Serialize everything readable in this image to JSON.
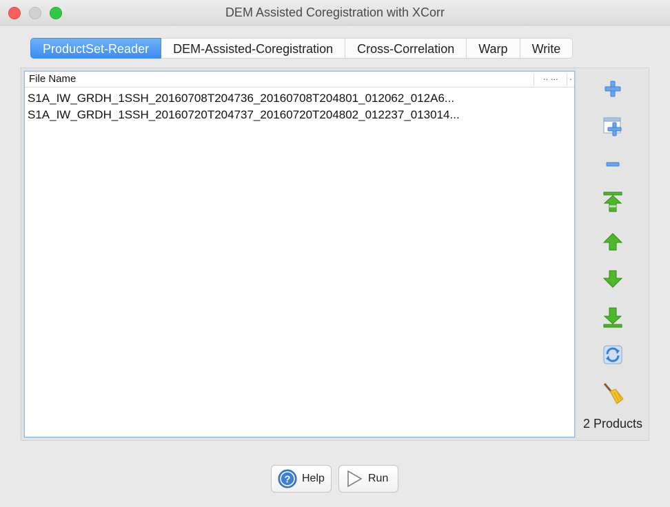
{
  "window": {
    "title": "DEM Assisted Coregistration with XCorr"
  },
  "tabs": [
    {
      "label": "ProductSet-Reader",
      "active": true
    },
    {
      "label": "DEM-Assisted-Coregistration",
      "active": false
    },
    {
      "label": "Cross-Correlation",
      "active": false
    },
    {
      "label": "Warp",
      "active": false
    },
    {
      "label": "Write",
      "active": false
    }
  ],
  "table": {
    "header": "File Name",
    "header_extra": ".. ...",
    "header_extra2": ".",
    "rows": [
      "S1A_IW_GRDH_1SSH_20160708T204736_20160708T204801_012062_012A6...",
      "S1A_IW_GRDH_1SSH_20160720T204737_20160720T204802_012237_013014..."
    ]
  },
  "sidebar": {
    "count_label": "2 Products",
    "icons": [
      "add-icon",
      "add-opened-icon",
      "remove-icon",
      "move-top-icon",
      "move-up-icon",
      "move-down-icon",
      "move-bottom-icon",
      "refresh-icon",
      "clear-broom-icon"
    ]
  },
  "buttons": {
    "help": "Help",
    "run": "Run"
  },
  "colors": {
    "tab_active": "#3d8bf3",
    "icon_green": "#4cb82a",
    "icon_blue": "#3b7fd4"
  }
}
